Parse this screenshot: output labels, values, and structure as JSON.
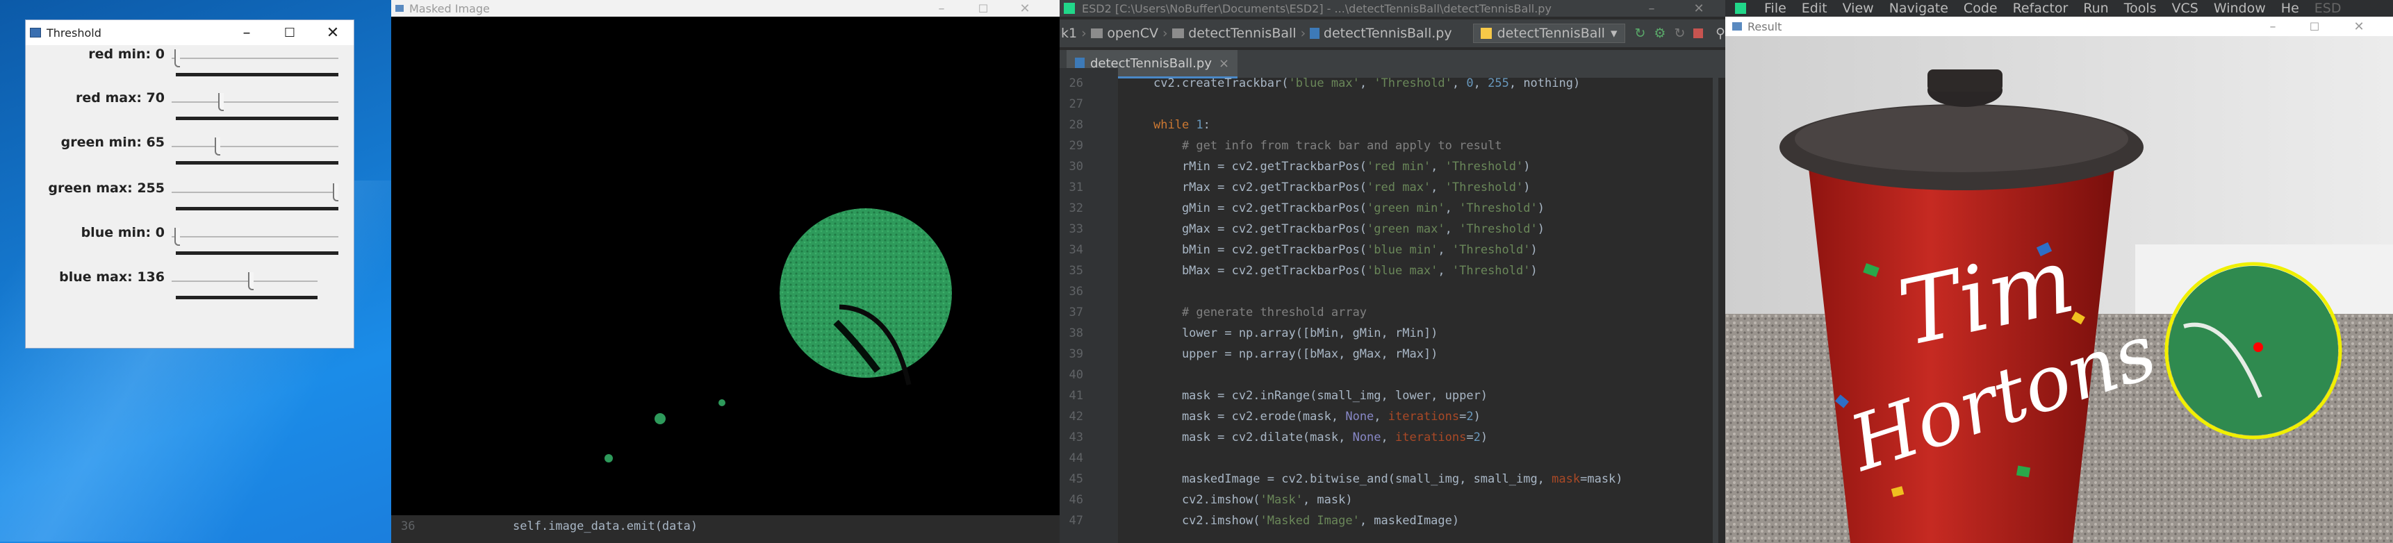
{
  "threshold_window": {
    "title": "Threshold",
    "sliders": [
      {
        "label": "red min: 0",
        "value": 0,
        "fraction": 0.0
      },
      {
        "label": "red max: 70",
        "value": 70,
        "fraction": 0.275
      },
      {
        "label": "green min: 65",
        "value": 65,
        "fraction": 0.255
      },
      {
        "label": "green max: 255",
        "value": 255,
        "fraction": 1.0
      },
      {
        "label": "blue min: 0",
        "value": 0,
        "fraction": 0.0
      },
      {
        "label": "blue max: 136",
        "value": 136,
        "fraction": 0.533
      }
    ]
  },
  "masked_window": {
    "title": "Masked Image",
    "overlay_line_number": "36",
    "overlay_code": "self.image_data.emit(data)"
  },
  "ide": {
    "title": "ESD2 [C:\\Users\\NoBuffer\\Documents\\ESD2] - ...\\detectTennisBall\\detectTennisBall.py",
    "breadcrumbs": [
      "k1",
      "openCV",
      "detectTennisBall",
      "detectTennisBall.py"
    ],
    "run_config": "detectTennisBall",
    "tab_label": "detectTennisBall.py",
    "code_lines": [
      {
        "n": "26",
        "segments": [
          {
            "c": "pl",
            "t": "cv2.createTrackbar("
          },
          {
            "c": "str",
            "t": "'blue max'"
          },
          {
            "c": "pl",
            "t": ", "
          },
          {
            "c": "str",
            "t": "'Threshold'"
          },
          {
            "c": "pl",
            "t": ", "
          },
          {
            "c": "num",
            "t": "0"
          },
          {
            "c": "pl",
            "t": ", "
          },
          {
            "c": "num",
            "t": "255"
          },
          {
            "c": "pl",
            "t": ", nothing)"
          }
        ]
      },
      {
        "n": "27",
        "segments": []
      },
      {
        "n": "28",
        "segments": [
          {
            "c": "kw",
            "t": "while "
          },
          {
            "c": "num",
            "t": "1"
          },
          {
            "c": "pl",
            "t": ":"
          }
        ]
      },
      {
        "n": "29",
        "segments": [
          {
            "c": "cm",
            "t": "    # get info from track bar and apply to result"
          }
        ]
      },
      {
        "n": "30",
        "segments": [
          {
            "c": "pl",
            "t": "    rMin = cv2.getTrackbarPos("
          },
          {
            "c": "str",
            "t": "'red min'"
          },
          {
            "c": "pl",
            "t": ", "
          },
          {
            "c": "str",
            "t": "'Threshold'"
          },
          {
            "c": "pl",
            "t": ")"
          }
        ]
      },
      {
        "n": "31",
        "segments": [
          {
            "c": "pl",
            "t": "    rMax = cv2.getTrackbarPos("
          },
          {
            "c": "str",
            "t": "'red max'"
          },
          {
            "c": "pl",
            "t": ", "
          },
          {
            "c": "str",
            "t": "'Threshold'"
          },
          {
            "c": "pl",
            "t": ")"
          }
        ]
      },
      {
        "n": "32",
        "segments": [
          {
            "c": "pl",
            "t": "    gMin = cv2.getTrackbarPos("
          },
          {
            "c": "str",
            "t": "'green min'"
          },
          {
            "c": "pl",
            "t": ", "
          },
          {
            "c": "str",
            "t": "'Threshold'"
          },
          {
            "c": "pl",
            "t": ")"
          }
        ]
      },
      {
        "n": "33",
        "segments": [
          {
            "c": "pl",
            "t": "    gMax = cv2.getTrackbarPos("
          },
          {
            "c": "str",
            "t": "'green max'"
          },
          {
            "c": "pl",
            "t": ", "
          },
          {
            "c": "str",
            "t": "'Threshold'"
          },
          {
            "c": "pl",
            "t": ")"
          }
        ]
      },
      {
        "n": "34",
        "segments": [
          {
            "c": "pl",
            "t": "    bMin = cv2.getTrackbarPos("
          },
          {
            "c": "str",
            "t": "'blue min'"
          },
          {
            "c": "pl",
            "t": ", "
          },
          {
            "c": "str",
            "t": "'Threshold'"
          },
          {
            "c": "pl",
            "t": ")"
          }
        ]
      },
      {
        "n": "35",
        "segments": [
          {
            "c": "pl",
            "t": "    bMax = cv2.getTrackbarPos("
          },
          {
            "c": "str",
            "t": "'blue max'"
          },
          {
            "c": "pl",
            "t": ", "
          },
          {
            "c": "str",
            "t": "'Threshold'"
          },
          {
            "c": "pl",
            "t": ")"
          }
        ]
      },
      {
        "n": "36",
        "segments": []
      },
      {
        "n": "37",
        "segments": [
          {
            "c": "cm",
            "t": "    # generate threshold array"
          }
        ]
      },
      {
        "n": "38",
        "segments": [
          {
            "c": "pl",
            "t": "    lower = np.array([bMin, gMin, rMin])"
          }
        ]
      },
      {
        "n": "39",
        "segments": [
          {
            "c": "pl",
            "t": "    upper = np.array([bMax, gMax, rMax])"
          }
        ]
      },
      {
        "n": "40",
        "segments": []
      },
      {
        "n": "41",
        "segments": [
          {
            "c": "pl",
            "t": "    mask = cv2.inRange(small_img, lower, upper)"
          }
        ]
      },
      {
        "n": "42",
        "segments": [
          {
            "c": "pl",
            "t": "    mask = cv2.erode(mask, "
          },
          {
            "c": "nm",
            "t": "None"
          },
          {
            "c": "pl",
            "t": ", "
          },
          {
            "c": "prm",
            "t": "iterations"
          },
          {
            "c": "pl",
            "t": "="
          },
          {
            "c": "num",
            "t": "2"
          },
          {
            "c": "pl",
            "t": ")"
          }
        ]
      },
      {
        "n": "43",
        "segments": [
          {
            "c": "pl",
            "t": "    mask = cv2.dilate(mask, "
          },
          {
            "c": "nm",
            "t": "None"
          },
          {
            "c": "pl",
            "t": ", "
          },
          {
            "c": "prm",
            "t": "iterations"
          },
          {
            "c": "pl",
            "t": "="
          },
          {
            "c": "num",
            "t": "2"
          },
          {
            "c": "pl",
            "t": ")"
          }
        ]
      },
      {
        "n": "44",
        "segments": []
      },
      {
        "n": "45",
        "segments": [
          {
            "c": "pl",
            "t": "    maskedImage = cv2.bitwise_and(small_img, small_img, "
          },
          {
            "c": "prm",
            "t": "mask"
          },
          {
            "c": "pl",
            "t": "=mask)"
          }
        ]
      },
      {
        "n": "46",
        "segments": [
          {
            "c": "pl",
            "t": "    cv2.imshow("
          },
          {
            "c": "str",
            "t": "'Mask'"
          },
          {
            "c": "pl",
            "t": ", mask)"
          }
        ]
      },
      {
        "n": "47",
        "segments": [
          {
            "c": "pl",
            "t": "    cv2.imshow("
          },
          {
            "c": "str",
            "t": "'Masked Image'"
          },
          {
            "c": "pl",
            "t": ", maskedImage)"
          }
        ]
      }
    ]
  },
  "menu": [
    "File",
    "Edit",
    "View",
    "Navigate",
    "Code",
    "Refactor",
    "Run",
    "Tools",
    "VCS",
    "Window",
    "He",
    "ESD"
  ],
  "result_window": {
    "title": "Result",
    "cup_text_1": "Tim",
    "cup_text_2": "Hortons"
  },
  "colors": {
    "desktop_blue": "#1b78d8",
    "ide_bg": "#2b2b2b",
    "tennis_green": "#2f9a5a",
    "circle_yellow": "#f0f000",
    "center_red": "#ff0000"
  }
}
